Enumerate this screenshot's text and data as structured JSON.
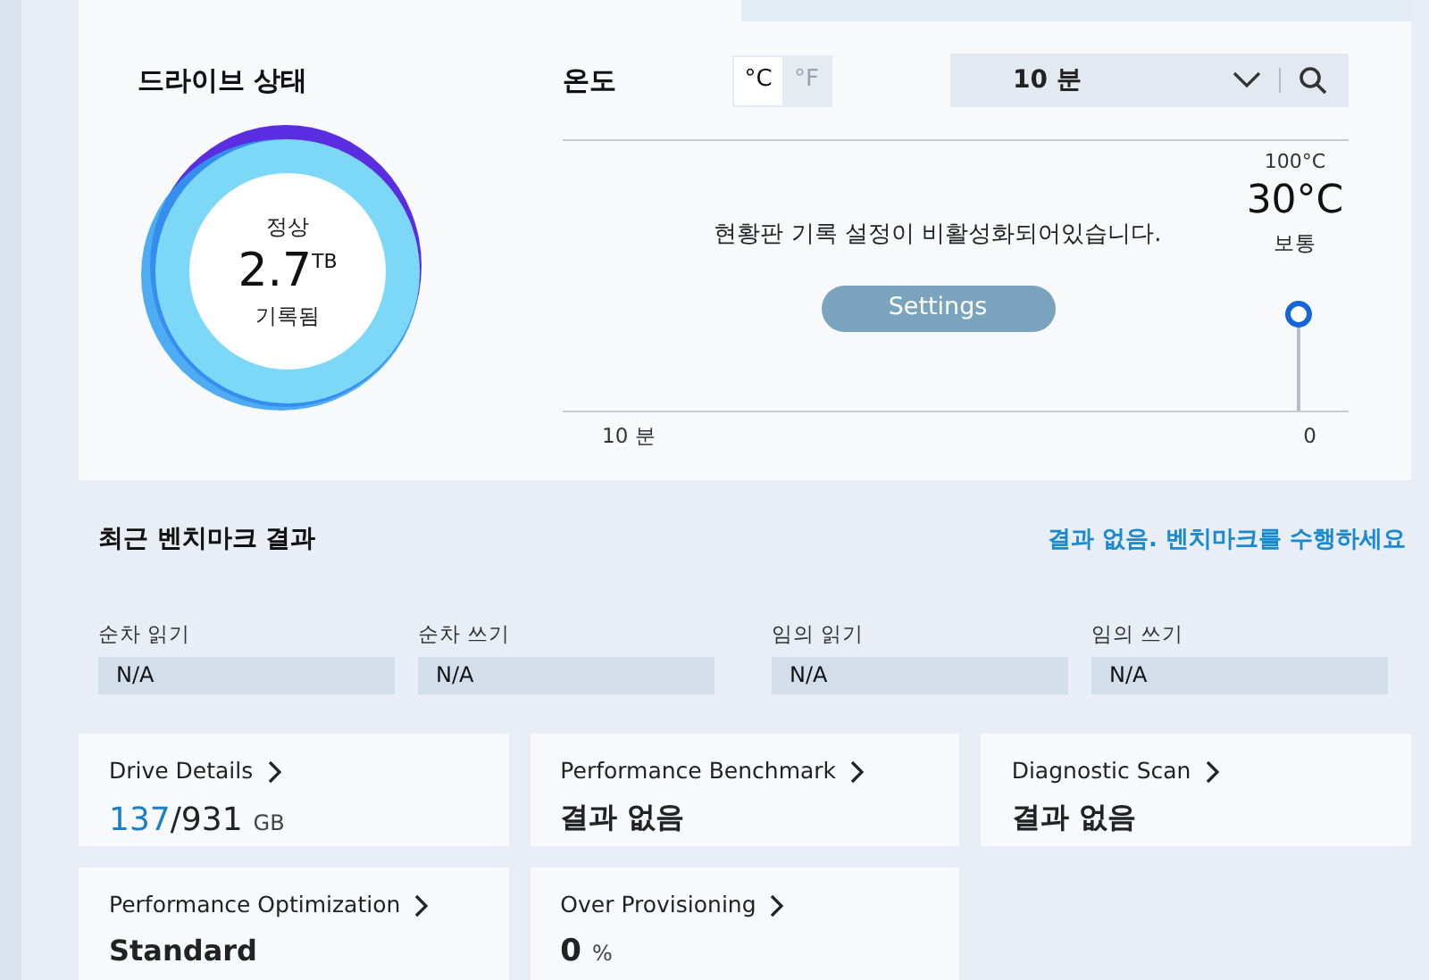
{
  "drive_status": {
    "title": "드라이브 상태",
    "status": "정상",
    "amount": "2.7",
    "unit": "TB",
    "caption": "기록됨"
  },
  "temperature": {
    "title": "온도",
    "units": [
      {
        "label": "°C",
        "selected": true
      },
      {
        "label": "°F",
        "selected": false
      }
    ],
    "range": {
      "value": "10 분"
    },
    "message": "현황판 기록 설정이 비활성화되어있습니다.",
    "settings_button": "Settings",
    "x_start": "10 분",
    "x_end": "0",
    "gauge": {
      "max": "100°C",
      "reading": "30°C",
      "status": "보통"
    }
  },
  "benchmark": {
    "title": "최근 벤치마크 결과",
    "link": "결과 없음. 벤치마크를 수행하세요",
    "metrics": [
      {
        "label": "순차 읽기",
        "value": "N/A"
      },
      {
        "label": "순차 쓰기",
        "value": "N/A"
      },
      {
        "label": "임의 읽기",
        "value": "N/A"
      },
      {
        "label": "임의 쓰기",
        "value": "N/A"
      }
    ]
  },
  "cards": [
    {
      "kind": "capacity",
      "title": "Drive Details",
      "used": "137",
      "total": "/931",
      "unit": "GB"
    },
    {
      "kind": "text",
      "title": "Performance Benchmark",
      "value": "결과 없음"
    },
    {
      "kind": "text",
      "title": "Diagnostic Scan",
      "value": "결과 없음"
    },
    {
      "kind": "text",
      "title": "Performance Optimization",
      "value": "Standard"
    },
    {
      "kind": "percent",
      "title": "Over Provisioning",
      "value": "0",
      "unit": "%"
    }
  ]
}
